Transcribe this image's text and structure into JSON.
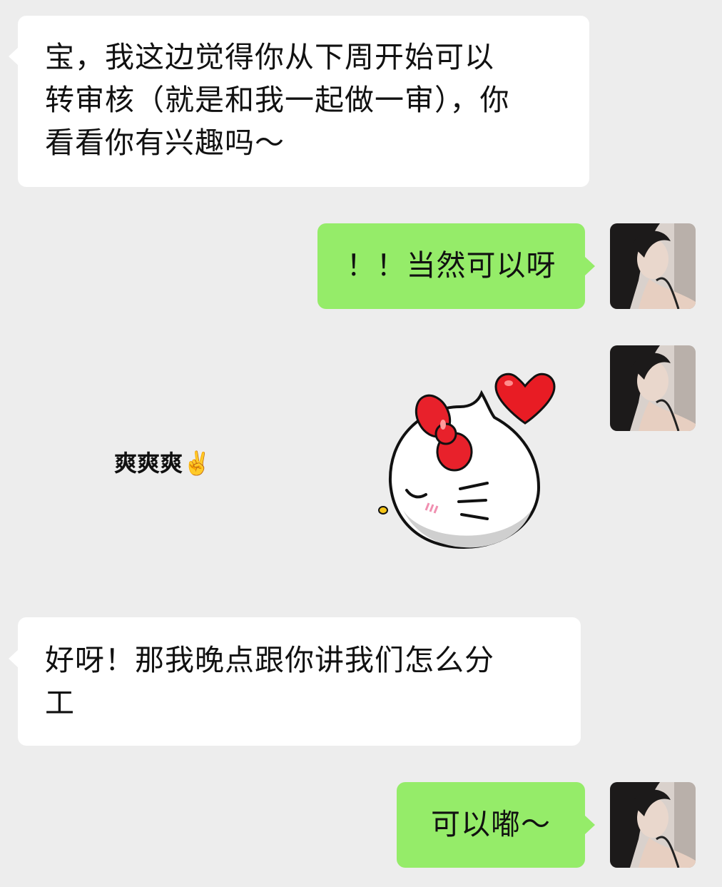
{
  "messages": [
    {
      "id": "m1",
      "side": "incoming",
      "lines": [
        "宝，我这边觉得你从下周开始可以",
        "转审核（就是和我一起做一审），你",
        "看看你有兴趣吗～"
      ]
    },
    {
      "id": "m2",
      "side": "outgoing",
      "text": "！！当然可以呀"
    },
    {
      "id": "m3",
      "side": "outgoing",
      "type": "sticker",
      "caption": "爽爽爽✌️",
      "icon": "hello-kitty-heart-sticker"
    },
    {
      "id": "m4",
      "side": "incoming",
      "lines": [
        "好呀！那我晚点跟你讲我们怎么分",
        "工"
      ]
    },
    {
      "id": "m5",
      "side": "outgoing",
      "text": "可以嘟～"
    }
  ],
  "colors": {
    "background": "#ededed",
    "incoming_bubble": "#ffffff",
    "outgoing_bubble": "#95ec69",
    "sticker_bow": "#e8212b",
    "sticker_heart": "#e81c24"
  },
  "icons": {
    "avatar": "user-avatar-photo",
    "sticker": "hello-kitty-heart-sticker"
  }
}
